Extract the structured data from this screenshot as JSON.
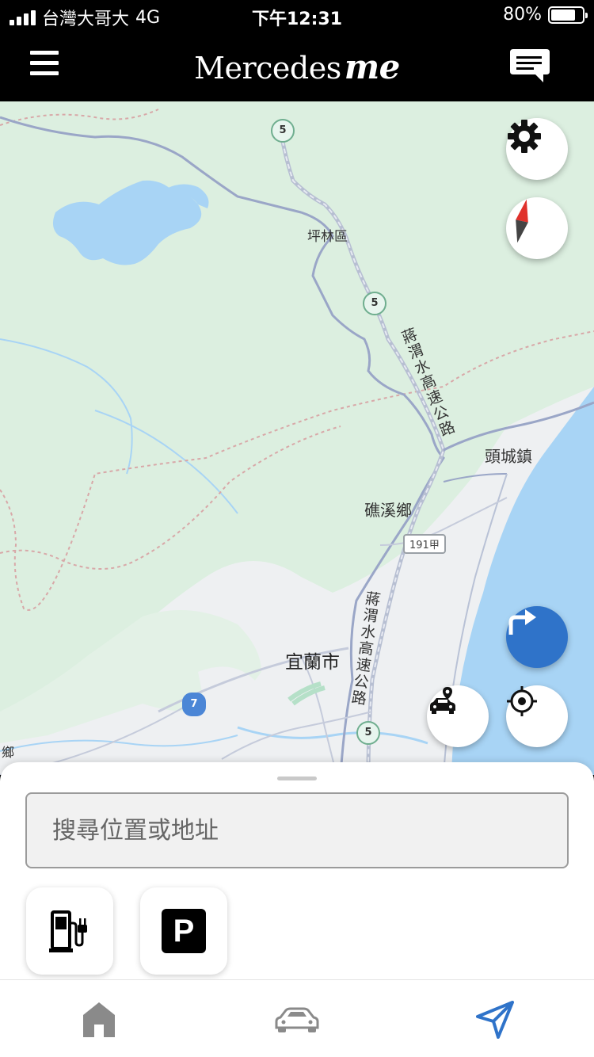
{
  "status_bar": {
    "carrier": "台灣大哥大",
    "network": "4G",
    "time": "下午12:31",
    "battery_percent": "80%",
    "battery_level": 0.8
  },
  "header": {
    "brand_main": "Mercedes",
    "brand_suffix": "me",
    "menu_icon": "hamburger-menu-icon",
    "chat_icon": "chat-bubble-icon"
  },
  "map": {
    "labels": {
      "pinglin": "坪林區",
      "toucheng": "頭城鎮",
      "jiaoxi": "礁溪鄉",
      "yilan": "宜蘭市",
      "highway_upper": "蔣渭水高速公路",
      "highway_lower": "蔣渭水高速公路",
      "edge_left": "鄉"
    },
    "shields": {
      "fwy5_a": "5",
      "fwy5_b": "5",
      "fwy5_c": "5",
      "prov7": "7",
      "road191": "191甲"
    },
    "buttons": {
      "settings": "gear-icon",
      "compass": "compass-icon",
      "route": "turn-right-arrow-icon",
      "car_location": "car-location-icon",
      "my_location": "crosshair-icon"
    },
    "colors": {
      "water": "#a8d4f5",
      "forest": "#dcefe0",
      "route_button": "#2f73c9",
      "compass_red": "#e0312b"
    }
  },
  "sheet": {
    "search_placeholder": "搜尋位置或地址",
    "quick_actions": [
      {
        "name": "charging-station",
        "icon": "ev-charger-icon"
      },
      {
        "name": "parking",
        "icon": "parking-icon",
        "label": "P"
      }
    ]
  },
  "tabbar": {
    "tabs": [
      {
        "name": "home",
        "icon": "home-icon",
        "active": false
      },
      {
        "name": "vehicle",
        "icon": "car-icon",
        "active": false
      },
      {
        "name": "navigation",
        "icon": "navigation-arrow-icon",
        "active": true
      }
    ],
    "active_color": "#2f73c9",
    "inactive_color": "#8a8a8a"
  }
}
